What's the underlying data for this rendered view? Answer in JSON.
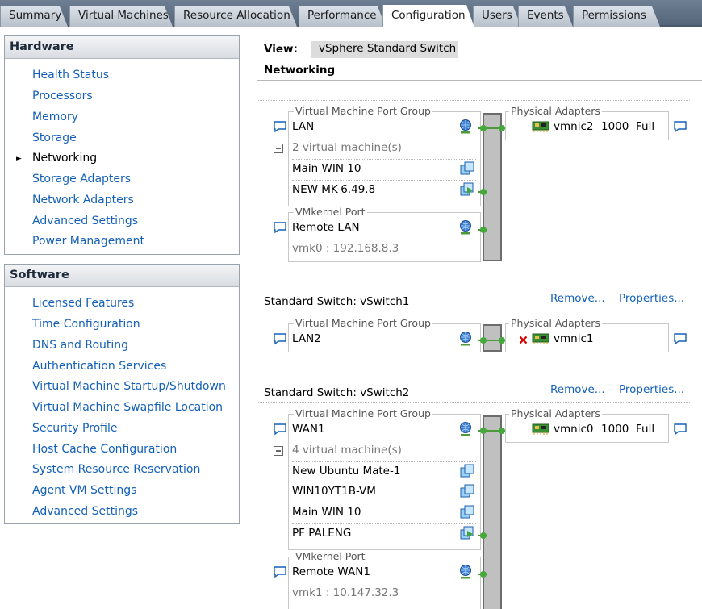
{
  "tabs": [
    "Summary",
    "Virtual Machines",
    "Resource Allocation",
    "Performance",
    "Configuration",
    "Users",
    "Events",
    "Permissions"
  ],
  "active_tab": "Configuration",
  "hardware": {
    "title": "Hardware",
    "items": [
      "Health Status",
      "Processors",
      "Memory",
      "Storage",
      "Networking",
      "Storage Adapters",
      "Network Adapters",
      "Advanced Settings",
      "Power Management"
    ],
    "current": "Networking"
  },
  "software": {
    "title": "Software",
    "items": [
      "Licensed Features",
      "Time Configuration",
      "DNS and Routing",
      "Authentication Services",
      "Virtual Machine Startup/Shutdown",
      "Virtual Machine Swapfile Location",
      "Security Profile",
      "Host Cache Configuration",
      "System Resource Reservation",
      "Agent VM Settings",
      "Advanced Settings"
    ]
  },
  "view": {
    "label": "View:",
    "value": "vSphere Standard Switch"
  },
  "section_title": "Networking",
  "switch0": {
    "vm_group_legend": "Virtual Machine Port Group",
    "port_group": "LAN",
    "vm_count": "2 virtual machine(s)",
    "vms": [
      "Main WIN 10",
      "NEW MK-6.49.8"
    ],
    "vmk_legend": "VMkernel Port",
    "vmk_name": "Remote LAN",
    "vmk_ip": "vmk0 : 192.168.8.3",
    "pa_legend": "Physical Adapters",
    "nic": {
      "name": "vmnic2",
      "speed": "1000",
      "duplex": "Full"
    }
  },
  "switch1": {
    "title": "Standard Switch: vSwitch1",
    "remove": "Remove...",
    "properties": "Properties...",
    "vm_group_legend": "Virtual Machine Port Group",
    "port_group": "LAN2",
    "pa_legend": "Physical Adapters",
    "nic": {
      "name": "vmnic1"
    }
  },
  "switch2": {
    "title": "Standard Switch: vSwitch2",
    "remove": "Remove...",
    "properties": "Properties...",
    "vm_group_legend": "Virtual Machine Port Group",
    "port_group": "WAN1",
    "vm_count": "4 virtual machine(s)",
    "vms": [
      "New Ubuntu Mate-1",
      "WIN10YT1B-VM",
      "Main WIN 10",
      "PF PALENG"
    ],
    "vmk_legend": "VMkernel Port",
    "vmk_name": "Remote WAN1",
    "vmk_ip": "vmk1 : 10.147.32.3",
    "pa_legend": "Physical Adapters",
    "nic": {
      "name": "vmnic0",
      "speed": "1000",
      "duplex": "Full"
    }
  },
  "colors": {
    "link": "#1460b8",
    "wire": "#4c9a3a",
    "tab_active": "#ffffff",
    "disconnected": "#d40000"
  }
}
